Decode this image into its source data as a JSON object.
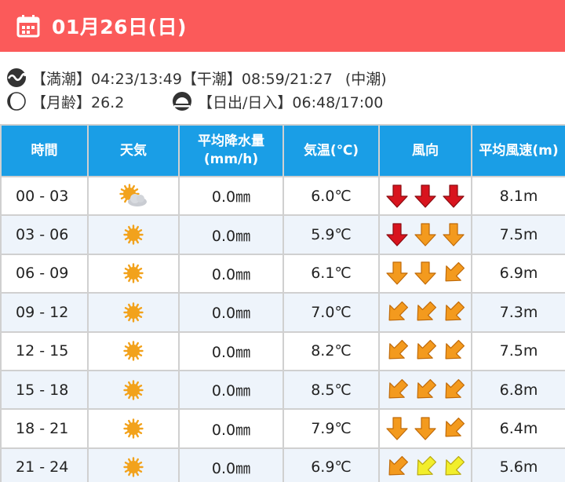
{
  "header": {
    "date": "01月26日(日)"
  },
  "tide_info": {
    "high": "【満潮】04:23/13:49",
    "low": "【干潮】08:59/21:27",
    "tide_type": "(中潮)",
    "moon_age": "【月齢】26.2",
    "sun": "【日出/日入】06:48/17:00"
  },
  "table": {
    "headers": {
      "time": "時間",
      "weather": "天気",
      "precip_line1": "平均降水量",
      "precip_line2": "(mm/h)",
      "temp": "気温(℃)",
      "wind_dir": "風向",
      "wind_speed": "平均風速(m)"
    },
    "rows": [
      {
        "time": "00 - 03",
        "weather": "partly-cloudy-icon",
        "precip": "0.0㎜",
        "temp": "6.0℃",
        "wind": [
          "down-red",
          "down-red",
          "down-red"
        ],
        "speed": "8.1m"
      },
      {
        "time": "03 - 06",
        "weather": "sunny-icon",
        "precip": "0.0㎜",
        "temp": "5.9℃",
        "wind": [
          "down-red",
          "down-orange",
          "down-orange"
        ],
        "speed": "7.5m"
      },
      {
        "time": "06 - 09",
        "weather": "sunny-icon",
        "precip": "0.0㎜",
        "temp": "6.1℃",
        "wind": [
          "down-orange",
          "down-orange",
          "downleft-orange"
        ],
        "speed": "6.9m"
      },
      {
        "time": "09 - 12",
        "weather": "sunny-icon",
        "precip": "0.0㎜",
        "temp": "7.0℃",
        "wind": [
          "downleft-orange",
          "downleft-orange",
          "downleft-orange"
        ],
        "speed": "7.3m"
      },
      {
        "time": "12 - 15",
        "weather": "sunny-icon",
        "precip": "0.0㎜",
        "temp": "8.2℃",
        "wind": [
          "downleft-orange",
          "downleft-orange",
          "downleft-orange"
        ],
        "speed": "7.5m"
      },
      {
        "time": "15 - 18",
        "weather": "sunny-icon",
        "precip": "0.0㎜",
        "temp": "8.5℃",
        "wind": [
          "downleft-orange",
          "downleft-orange",
          "downleft-orange"
        ],
        "speed": "6.8m"
      },
      {
        "time": "18 - 21",
        "weather": "sunny-icon",
        "precip": "0.0㎜",
        "temp": "7.9℃",
        "wind": [
          "down-orange",
          "down-orange",
          "downleft-orange"
        ],
        "speed": "6.4m"
      },
      {
        "time": "21 - 24",
        "weather": "sunny-icon",
        "precip": "0.0㎜",
        "temp": "6.9℃",
        "wind": [
          "downleft-orange",
          "downleft-yellow",
          "downleft-yellow"
        ],
        "speed": "5.6m"
      }
    ]
  },
  "colors": {
    "header_bg": "#fb5a5a",
    "table_header_bg": "#1a9ee6",
    "arrow_red": "#d8141e",
    "arrow_orange": "#f39a1e",
    "arrow_yellow": "#f2ee2c",
    "sun": "#f2a21c"
  }
}
